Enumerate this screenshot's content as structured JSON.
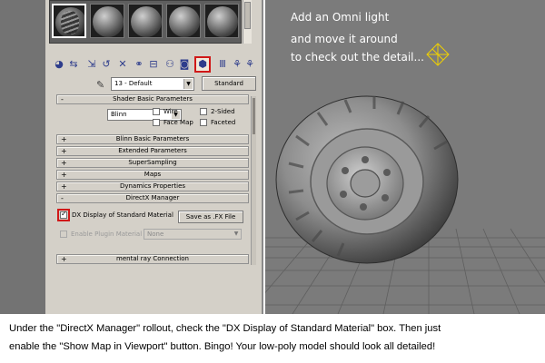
{
  "material_slots": [
    "tire-material-slot",
    "sphere-slot-2",
    "sphere-slot-3",
    "sphere-slot-4",
    "sphere-slot-5"
  ],
  "toolbar_icons": [
    "get-material-icon",
    "put-to-scene-icon",
    "assign-material-icon",
    "reset-icon",
    "delete-icon",
    "make-unique-icon",
    "put-library-icon",
    "material-id-icon",
    "show-map-in-viewport-icon",
    "show-end-result-icon",
    "go-parent-icon",
    "go-forward-icon"
  ],
  "material": {
    "name": "13 - Default",
    "type_button": "Standard"
  },
  "shader_basic": {
    "title": "Shader Basic Parameters",
    "shader": "Blinn",
    "wire": "Wire",
    "two_sided": "2-Sided",
    "face_map": "Face Map",
    "faceted": "Faceted"
  },
  "rollouts": {
    "blinn_basic": "Blinn Basic Parameters",
    "extended": "Extended Parameters",
    "supersampling": "SuperSampling",
    "maps": "Maps",
    "dynamics": "Dynamics Properties",
    "directx": "DirectX Manager",
    "mental_ray": "mental ray Connection"
  },
  "directx": {
    "dx_display_label": "DX Display of Standard Material",
    "dx_display_checked": true,
    "save_fx_label": "Save as .FX File",
    "enable_plugin_label": "Enable Plugin Material",
    "plugin_value": "None"
  },
  "viewport": {
    "line1": "Add an Omni light",
    "line2": "and move it around",
    "line3": "to check out the detail..."
  },
  "caption": {
    "line1": "Under the \"DirectX Manager\" rollout, check the \"DX Display of Standard Material\" box. Then just",
    "line2": "enable the \"Show Map in Viewport\" button. Bingo! Your low-poly model should look all detailed!"
  },
  "colors": {
    "highlight_red": "#d01818",
    "panel_bg": "#d4d0c8",
    "viewport_bg": "#7b7b7b"
  }
}
